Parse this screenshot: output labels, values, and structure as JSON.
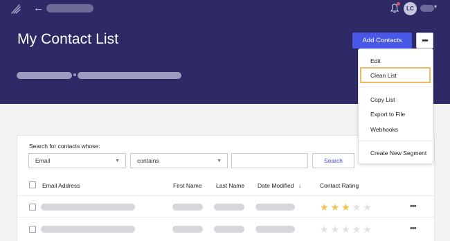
{
  "header": {
    "title": "My Contact List",
    "add_contacts_label": "Add Contacts",
    "avatar_initials": "LC",
    "back_arrow": "←",
    "more_glyph": "•••"
  },
  "menu": {
    "items": [
      "Edit",
      "Clean List",
      "Copy List",
      "Export to File",
      "Webhooks",
      "Create New Segment"
    ]
  },
  "search": {
    "label": "Search for contacts whose:",
    "field_value": "Email",
    "operator_value": "contains",
    "input_value": "",
    "button_label": "Search"
  },
  "table": {
    "columns": [
      "Email Address",
      "First Name",
      "Last Name",
      "Date Modified",
      "Contact Rating"
    ],
    "sort_indicator": "↓",
    "rows": [
      {
        "rating": 3,
        "max_rating": 5
      },
      {
        "rating": 0,
        "max_rating": 5
      }
    ]
  },
  "colors": {
    "header_bg": "#2d2a66",
    "primary_button": "#4857e6",
    "highlight_border": "#f0b864",
    "star_filled": "#efc54a"
  }
}
